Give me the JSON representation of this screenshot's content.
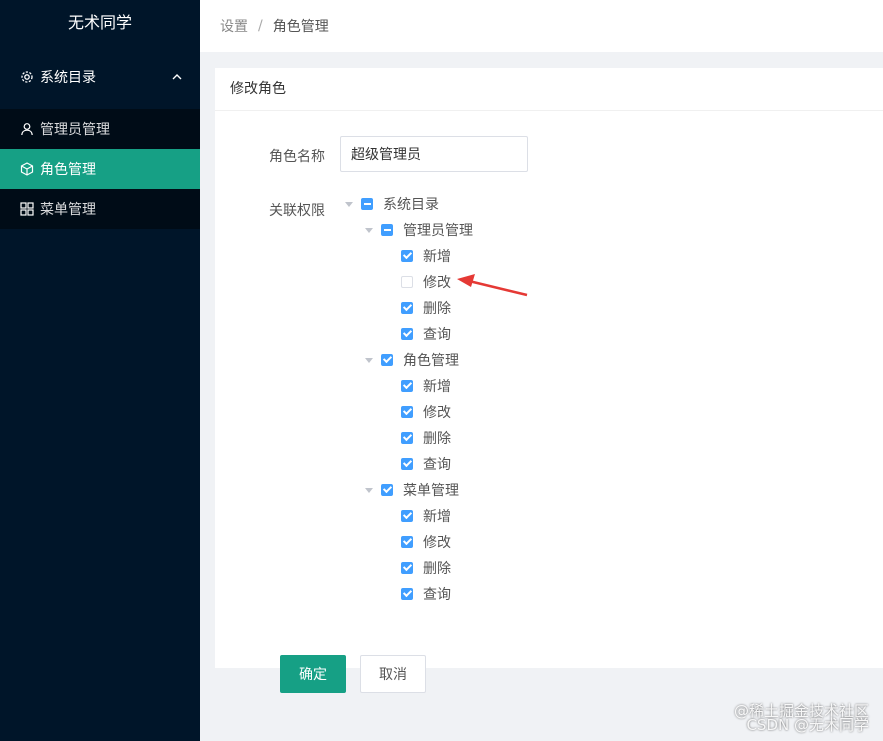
{
  "sidebar": {
    "logo": "无术同学",
    "group": {
      "label": "系统目录"
    },
    "items": [
      {
        "label": "管理员管理",
        "icon": "user-icon"
      },
      {
        "label": "角色管理",
        "icon": "cube-icon",
        "active": true
      },
      {
        "label": "菜单管理",
        "icon": "grid-icon"
      }
    ]
  },
  "breadcrumb": {
    "root": "设置",
    "separator": "/",
    "current": "角色管理"
  },
  "card": {
    "title": "修改角色"
  },
  "form": {
    "name_label": "角色名称",
    "name_value": "超级管理员",
    "perm_label": "关联权限"
  },
  "tree": {
    "root": {
      "label": "系统目录",
      "state": "indeterminate"
    },
    "groups": [
      {
        "label": "管理员管理",
        "state": "indeterminate",
        "children": [
          {
            "label": "新增",
            "checked": true
          },
          {
            "label": "修改",
            "checked": false
          },
          {
            "label": "删除",
            "checked": true
          },
          {
            "label": "查询",
            "checked": true
          }
        ]
      },
      {
        "label": "角色管理",
        "state": "checked",
        "children": [
          {
            "label": "新增",
            "checked": true
          },
          {
            "label": "修改",
            "checked": true
          },
          {
            "label": "删除",
            "checked": true
          },
          {
            "label": "查询",
            "checked": true
          }
        ]
      },
      {
        "label": "菜单管理",
        "state": "checked",
        "children": [
          {
            "label": "新增",
            "checked": true
          },
          {
            "label": "修改",
            "checked": true
          },
          {
            "label": "删除",
            "checked": true
          },
          {
            "label": "查询",
            "checked": true
          }
        ]
      }
    ]
  },
  "buttons": {
    "confirm": "确定",
    "cancel": "取消"
  },
  "watermark": {
    "line1": "@稀土掘金技术社区",
    "line2": "CSDN @无术同学"
  },
  "colors": {
    "accent": "#16a085",
    "checkbox": "#409eff",
    "sidebar": "#001529",
    "arrow": "#e53935"
  }
}
